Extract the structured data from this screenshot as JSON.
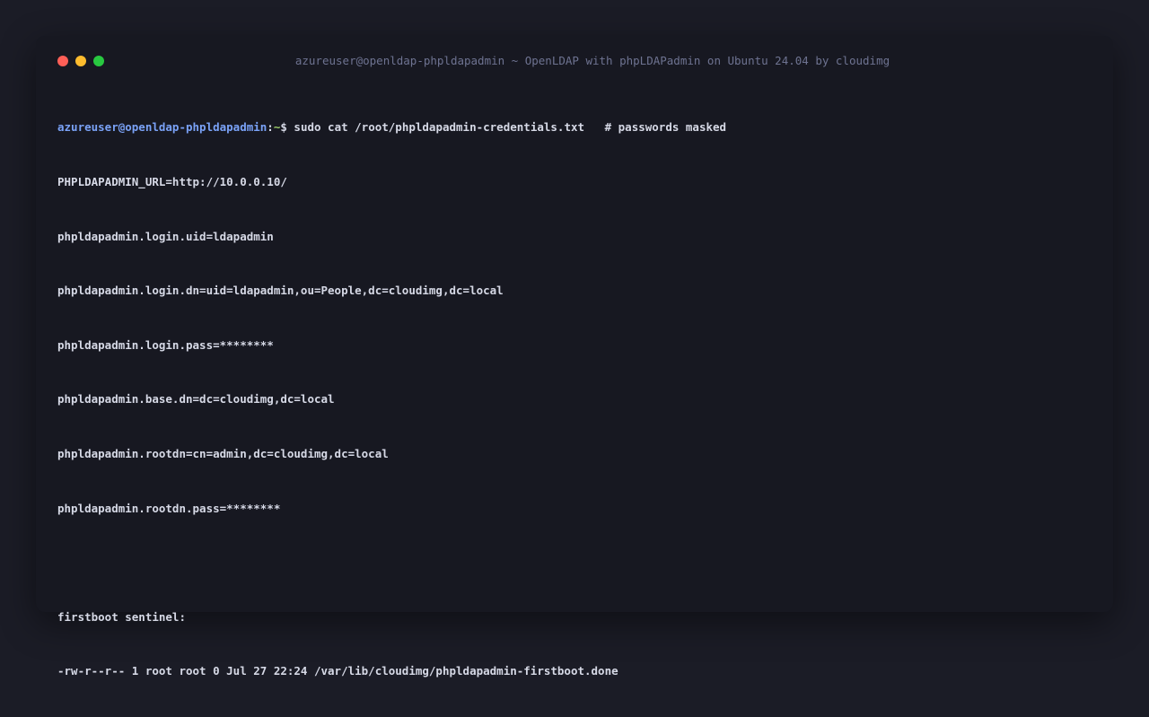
{
  "window": {
    "title": "azureuser@openldap-phpldapadmin ~ OpenLDAP with phpLDAPadmin on Ubuntu 24.04 by cloudimg",
    "controls": {
      "close_color": "#ff5f57",
      "minimize_color": "#febc2e",
      "maximize_color": "#28c840"
    }
  },
  "terminal": {
    "prompt": {
      "user_host": "azureuser@openldap-phpldapadmin",
      "colon": ":",
      "path": "~",
      "symbol": "$",
      "command": " sudo cat /root/phpldapadmin-credentials.txt   # passwords masked"
    },
    "output": [
      "PHPLDAPADMIN_URL=http://10.0.0.10/",
      "phpldapadmin.login.uid=ldapadmin",
      "phpldapadmin.login.dn=uid=ldapadmin,ou=People,dc=cloudimg,dc=local",
      "phpldapadmin.login.pass=********",
      "phpldapadmin.base.dn=dc=cloudimg,dc=local",
      "phpldapadmin.rootdn=cn=admin,dc=cloudimg,dc=local",
      "phpldapadmin.rootdn.pass=********",
      "",
      "firstboot sentinel:",
      "-rw-r--r-- 1 root root 0 Jul 27 22:24 /var/lib/cloudimg/phpldapadmin-firstboot.done"
    ]
  }
}
